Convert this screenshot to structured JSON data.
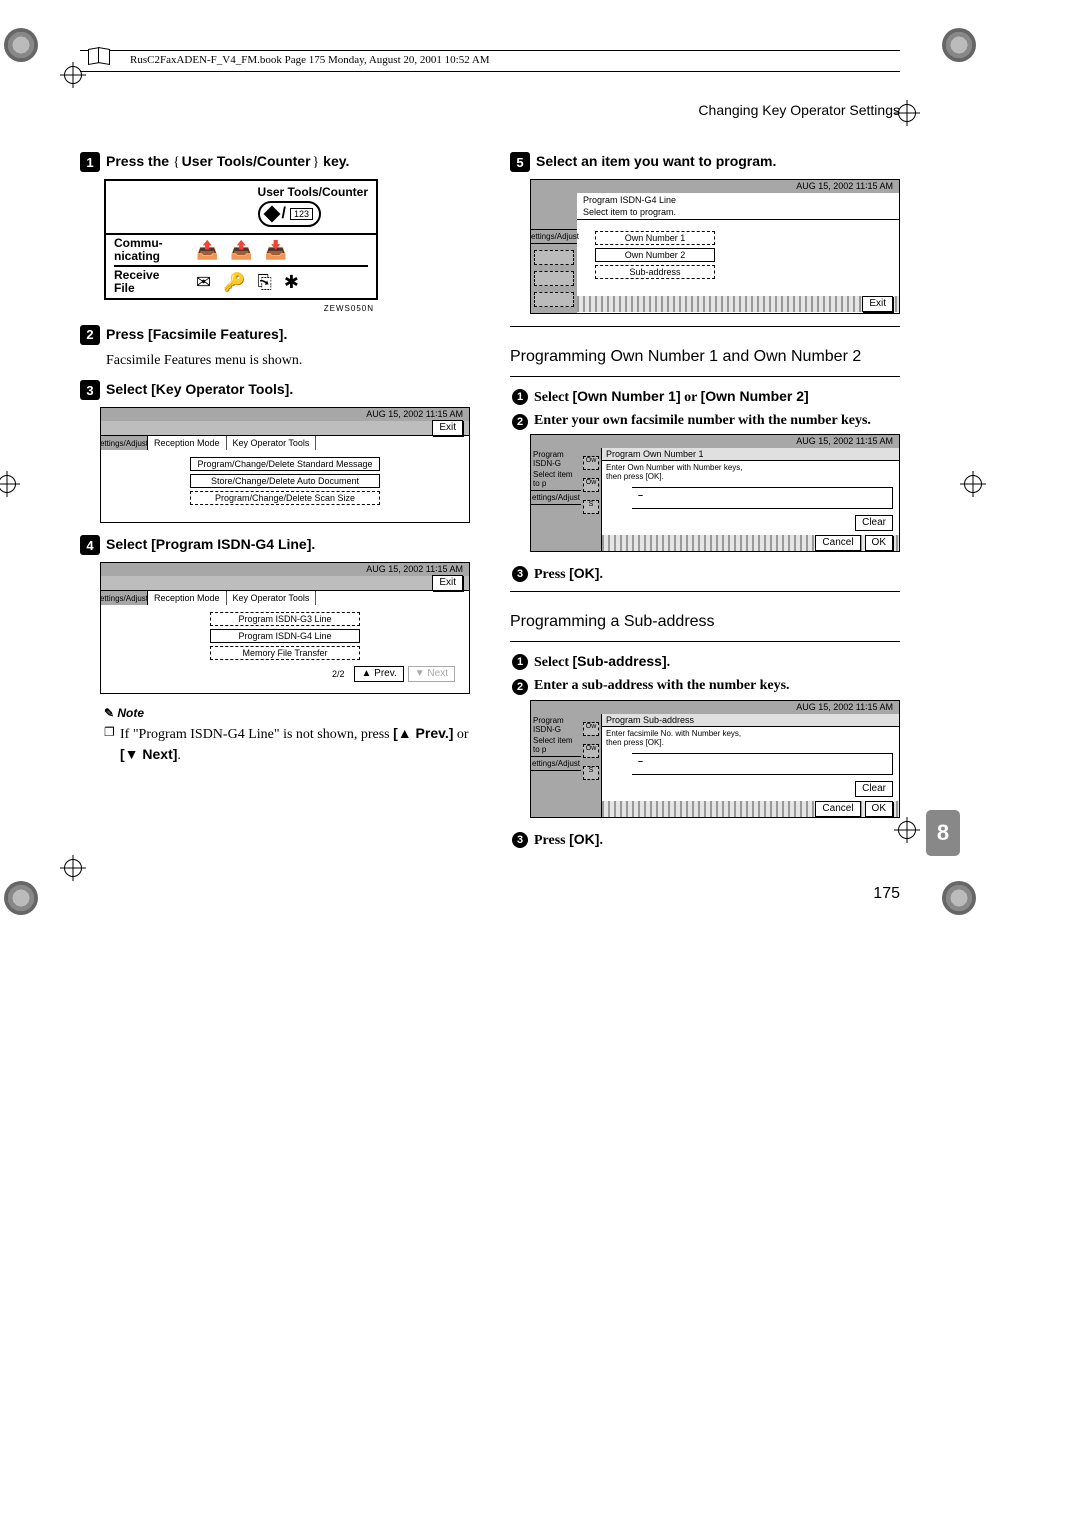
{
  "header_line": "RusC2FaxADEN-F_V4_FM.book  Page 175  Monday, August 20, 2001  10:52 AM",
  "section": "Changing Key Operator Settings",
  "left": {
    "s1": {
      "pre": "Press the ",
      "key": "User Tools/Counter",
      "post": " key."
    },
    "panelA": {
      "title": "User Tools/Counter",
      "row1": "Commu-\nnicating",
      "row2": "Receive\nFile",
      "numbox": "123",
      "code": "ZEWS050N"
    },
    "s2": {
      "text": "Press ",
      "boldSans": "[Facsimile Features]",
      "tail": "."
    },
    "s2body": "Facsimile Features menu is shown.",
    "s3": {
      "text": "Select ",
      "boldSans": "[Key Operator Tools]",
      "tail": "."
    },
    "shot1": {
      "time": "AUG 15, 2002  11∶15 AM",
      "exit": "Exit",
      "side": "ettings/Adjust",
      "tab1": "Reception Mode",
      "tab2": "Key Operator Tools",
      "items": [
        "Program/Change/Delete Standard Message",
        "Store/Change/Delete Auto Document",
        "Program/Change/Delete Scan Size"
      ]
    },
    "s4": {
      "text": "Select ",
      "boldSans": "[Program ISDN-G4 Line]",
      "tail": "."
    },
    "shot2": {
      "time": "AUG 15, 2002  11∶15 AM",
      "exit": "Exit",
      "side": "ettings/Adjust",
      "tab1": "Reception Mode",
      "tab2": "Key Operator Tools",
      "items": [
        "Program ISDN-G3 Line",
        "Program ISDN-G4 Line",
        "Memory File Transfer"
      ],
      "page": "2/2",
      "prev": "▲ Prev.",
      "next": "▼ Next"
    },
    "note": {
      "heading": "Note",
      "item": "If \"Program ISDN-G4 Line\" is not shown, press ",
      "k1": "[▲ Prev.]",
      "mid": " or ",
      "k2": "[▼ Next]",
      "tail": "."
    }
  },
  "right": {
    "s5": {
      "text": "Select an item you want to program."
    },
    "shot3": {
      "time": "AUG 15, 2002  11∶15 AM",
      "side": "ettings/Adjust",
      "crumb": "Program ISDN-G4 Line",
      "sub": "Select item to program.",
      "items": [
        "Own Number 1",
        "Own Number 2",
        "Sub-address"
      ],
      "exit": "Exit"
    },
    "head1": "Programming Own Number 1 and Own Number 2",
    "o1": {
      "text": "Select ",
      "k1": "[Own Number 1]",
      "mid": " or ",
      "k2": "[Own Number 2]"
    },
    "o2": "Enter your own facsimile number with the number keys.",
    "dlg1": {
      "time": "AUG 15, 2002  11∶15 AM",
      "side": "ettings/Adjust",
      "crumb": "Program ISDN-G",
      "title": "Program Own Number 1",
      "sub": "Select item to p",
      "hint": "Enter Own Number with Number keys,\nthen press [OK].",
      "clear": "Clear",
      "cancel": "Cancel",
      "ok": "OK",
      "row1": "Ow",
      "row2": "Ow",
      "row3": "S"
    },
    "o3": {
      "text": "Press ",
      "k": "[OK]",
      "tail": "."
    },
    "head2": "Programming a Sub-address",
    "p1": {
      "text": "Select ",
      "k": "[Sub-address]",
      "tail": "."
    },
    "p2": "Enter a sub-address with the number keys.",
    "dlg2": {
      "time": "AUG 15, 2002  11∶15 AM",
      "side": "ettings/Adjust",
      "crumb": "Program ISDN-G",
      "title": "Program Sub-address",
      "sub": "Select item to p",
      "hint": "Enter facsimile No. with Number keys,\nthen press [OK].",
      "clear": "Clear",
      "cancel": "Cancel",
      "ok": "OK",
      "row1": "Ow",
      "row2": "Ow",
      "row3": "S"
    },
    "p3": {
      "text": "Press ",
      "k": "[OK]",
      "tail": "."
    }
  },
  "chapter": "8",
  "pagenum": "175"
}
